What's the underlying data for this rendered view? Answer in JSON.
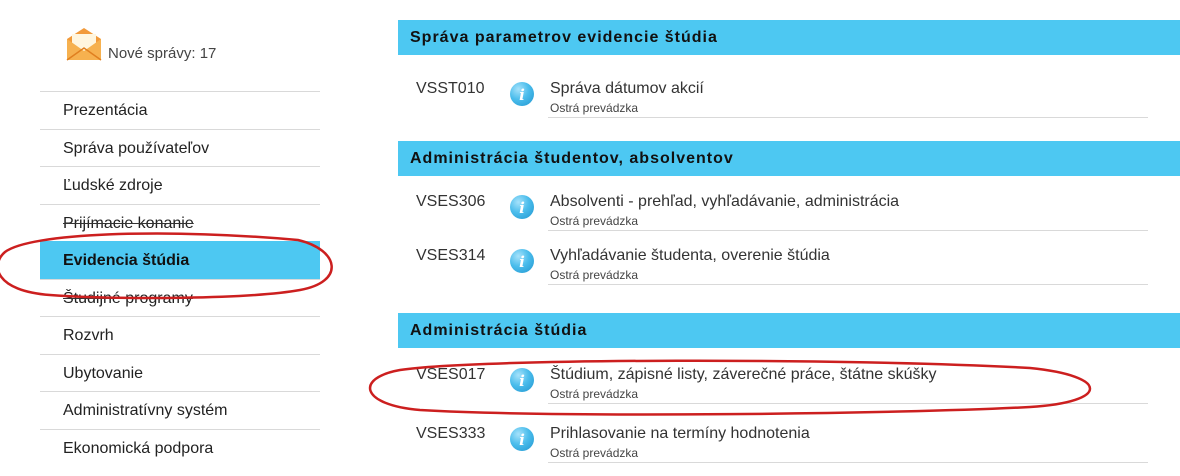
{
  "sidebar": {
    "messages": {
      "icon": "mail-icon",
      "label": "Nové správy: 17"
    },
    "menu": [
      {
        "label": "Prezentácia"
      },
      {
        "label": "Správa používateľov"
      },
      {
        "label": "Ľudské zdroje"
      },
      {
        "label": "Prijímacie konanie"
      },
      {
        "label": "Evidencia štúdia",
        "active": true
      },
      {
        "label": "Študijné programy"
      },
      {
        "label": "Rozvrh"
      },
      {
        "label": "Ubytovanie"
      },
      {
        "label": "Administratívny systém"
      },
      {
        "label": "Ekonomická podpora"
      }
    ]
  },
  "main": {
    "sections": [
      {
        "title": "Správa parametrov evidencie štúdia",
        "entries": [
          {
            "code": "VSST010",
            "title": "Správa dátumov akcií",
            "status": "Ostrá prevádzka"
          }
        ]
      },
      {
        "title": "Administrácia študentov, absolventov",
        "entries": [
          {
            "code": "VSES306",
            "title": "Absolventi - prehľad, vyhľadávanie, administrácia",
            "status": "Ostrá prevádzka"
          },
          {
            "code": "VSES314",
            "title": "Vyhľadávanie študenta, overenie štúdia",
            "status": "Ostrá prevádzka"
          }
        ]
      },
      {
        "title": "Administrácia štúdia",
        "entries": [
          {
            "code": "VSES017",
            "title": "Štúdium, zápisné listy, záverečné práce, štátne skúšky",
            "status": "Ostrá prevádzka"
          },
          {
            "code": "VSES333",
            "title": "Prihlasovanie na termíny hodnotenia",
            "status": "Ostrá prevádzka"
          }
        ]
      }
    ]
  },
  "colors": {
    "accent": "#4dc8f2",
    "annotation": "#cc1f1f"
  }
}
